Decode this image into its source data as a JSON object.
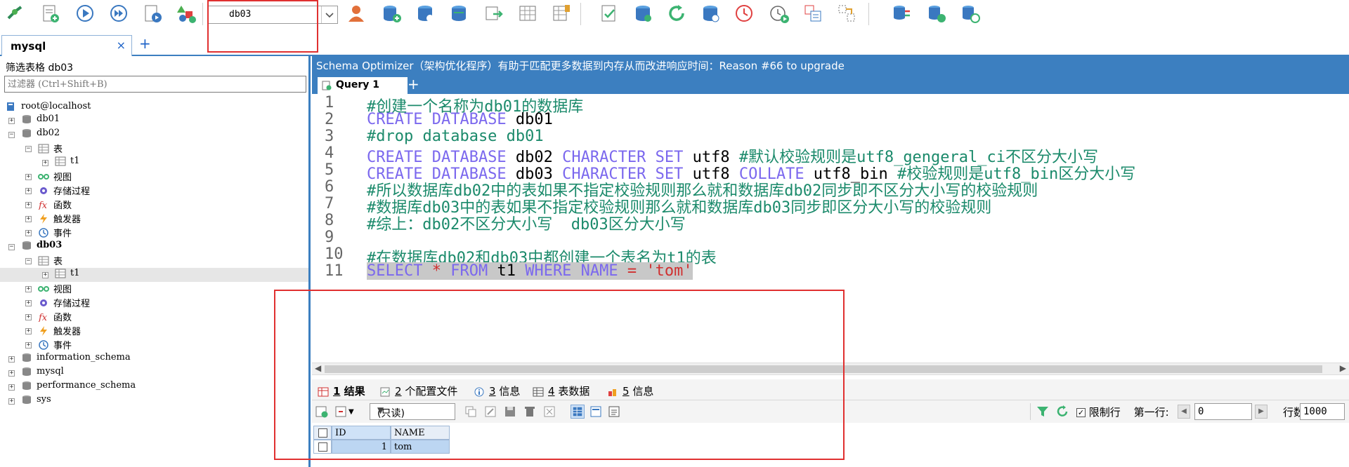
{
  "toolbar": {
    "db_select": "db03",
    "icons": [
      "new-connection-icon",
      "new-query-icon",
      "execute-icon",
      "execute-all-icon",
      "execute-explain-icon",
      "create-objects-icon",
      "user-manager-icon",
      "create-database-icon",
      "backup-database-icon",
      "restore-database-icon",
      "import-icon",
      "schema-designer-icon",
      "table-diagnostics-icon",
      "query-builder-icon",
      "sync-icon",
      "refresh-icon",
      "schema-sync-icon",
      "scheduler-icon",
      "run-job-icon",
      "data-compare-icon",
      "query-profiler-icon",
      "db-tools-icon",
      "db-sync-icon",
      "db-transfer-icon"
    ]
  },
  "connection": {
    "tab_label": "mysql",
    "close": "×",
    "add": "+"
  },
  "filter": {
    "title": "筛选表格 db03",
    "placeholder": "过滤器 (Ctrl+Shift+B)"
  },
  "tree": {
    "root": "root@localhost",
    "db01": "db01",
    "db02": "db02",
    "db02_tables": "表",
    "db02_t1": "t1",
    "db02_views": "视图",
    "db02_procs": "存储过程",
    "db02_funcs": "函数",
    "db02_triggers": "触发器",
    "db02_events": "事件",
    "db03": "db03",
    "db03_tables": "表",
    "db03_t1": "t1",
    "db03_views": "视图",
    "db03_procs": "存储过程",
    "db03_funcs": "函数",
    "db03_triggers": "触发器",
    "db03_events": "事件",
    "info_schema": "information_schema",
    "mysql": "mysql",
    "perf_schema": "performance_schema",
    "sys": "sys"
  },
  "notice": "Schema Optimizer（架构优化程序）有助于匹配更多数据到内存从而改进响应时间：Reason #66 to upgrade",
  "query_tab": {
    "label": "Query 1",
    "add": "+"
  },
  "editor": {
    "line_numbers": [
      "1",
      "2",
      "3",
      "4",
      "5",
      "6",
      "7",
      "8",
      "9",
      "10",
      "11"
    ],
    "l1": "#创建一个名称为db01的数据库",
    "l2_kw": "CREATE DATABASE",
    "l2_rest": " db01",
    "l3": "#drop database db01",
    "l4_kw1": "CREATE DATABASE",
    "l4_a": " db02 ",
    "l4_kw2": "CHARACTER SET",
    "l4_b": " utf8 ",
    "l4_cmt": "#默认校验规则是utf8_gengeral_ci不区分大小写",
    "l5_kw1": "CREATE DATABASE",
    "l5_a": " db03 ",
    "l5_kw2": "CHARACTER SET",
    "l5_b": " utf8 ",
    "l5_kw3": "COLLATE",
    "l5_c": " utf8_bin ",
    "l5_cmt": "#校验规则是utf8_bin区分大小写",
    "l6": "#所以数据库db02中的表如果不指定校验规则那么就和数据库db02同步即不区分大小写的校验规则",
    "l7": "#数据库db03中的表如果不指定校验规则那么就和数据库db03同步即区分大小写的校验规则",
    "l8": "#综上：db02不区分大小写  db03区分大小写",
    "l10": "#在数据库db02和db03中都创建一个表名为t1的表",
    "l11_kw1": "SELECT",
    "l11_op1": " * ",
    "l11_kw2": "FROM",
    "l11_a": " t1 ",
    "l11_kw3": "WHERE NAME",
    "l11_op2": " = ",
    "l11_str": "'tom'"
  },
  "result_tabs": [
    {
      "num": "1",
      "label": " 结果"
    },
    {
      "num": "2",
      "label": " 个配置文件"
    },
    {
      "num": "3",
      "label": " 信息"
    },
    {
      "num": "4",
      "label": " 表数据"
    },
    {
      "num": "5",
      "label": " 信息"
    }
  ],
  "result_bar": {
    "mode": "(只读)",
    "limit_label": "限制行",
    "first_row_label": "第一行:",
    "first_row_value": "0",
    "rows_label": "行数:",
    "rows_value": "1000"
  },
  "grid": {
    "columns": [
      "ID",
      "NAME"
    ],
    "rows": [
      [
        "1",
        "tom"
      ]
    ]
  }
}
